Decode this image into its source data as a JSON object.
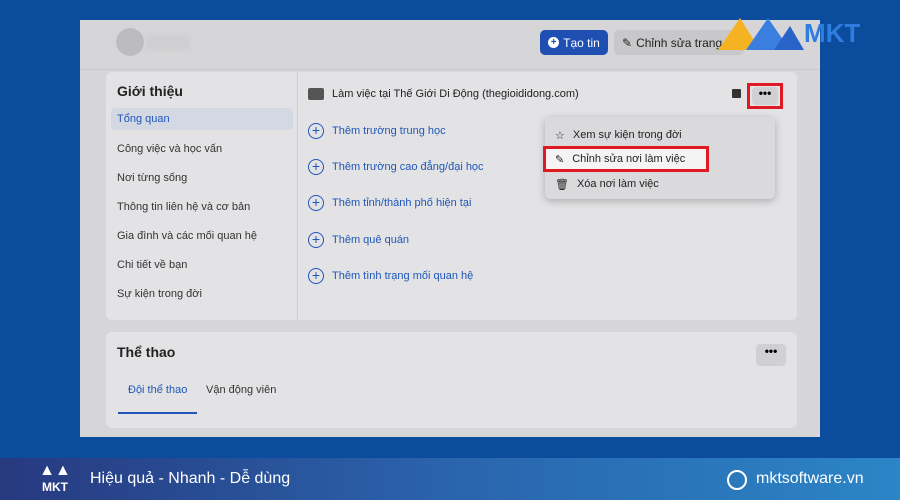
{
  "header": {
    "create_story": "Tạo tin",
    "edit_profile": "Chỉnh sửa trang cá nhân"
  },
  "about": {
    "title": "Giới thiệu",
    "items": [
      "Tổng quan",
      "Công việc và học vấn",
      "Nơi từng sống",
      "Thông tin liên hệ và cơ bản",
      "Gia đình và các mối quan hệ",
      "Chi tiết về bạn",
      "Sự kiện trong đời"
    ],
    "work": "Làm việc tại Thế Giới Di Động (thegioididong.com)",
    "add_items": [
      "Thêm trường trung học",
      "Thêm trường cao đẳng/đại học",
      "Thêm tỉnh/thành phố hiện tại",
      "Thêm quê quán",
      "Thêm tình trạng mối quan hệ"
    ],
    "more": "•••"
  },
  "menu": {
    "items": [
      "Xem sự kiện trong đời",
      "Chỉnh sửa nơi làm việc",
      "Xóa nơi làm việc"
    ]
  },
  "sports": {
    "title": "Thể thao",
    "tabs": [
      "Đội thể thao",
      "Vận động viên"
    ],
    "more": "•••"
  },
  "brand": {
    "logo": "MKT",
    "tagline": "Hiệu quả - Nhanh - Dễ dùng",
    "website": "mktsoftware.vn",
    "highlight_color": "#e01a22",
    "accent": "#1f56b8"
  }
}
